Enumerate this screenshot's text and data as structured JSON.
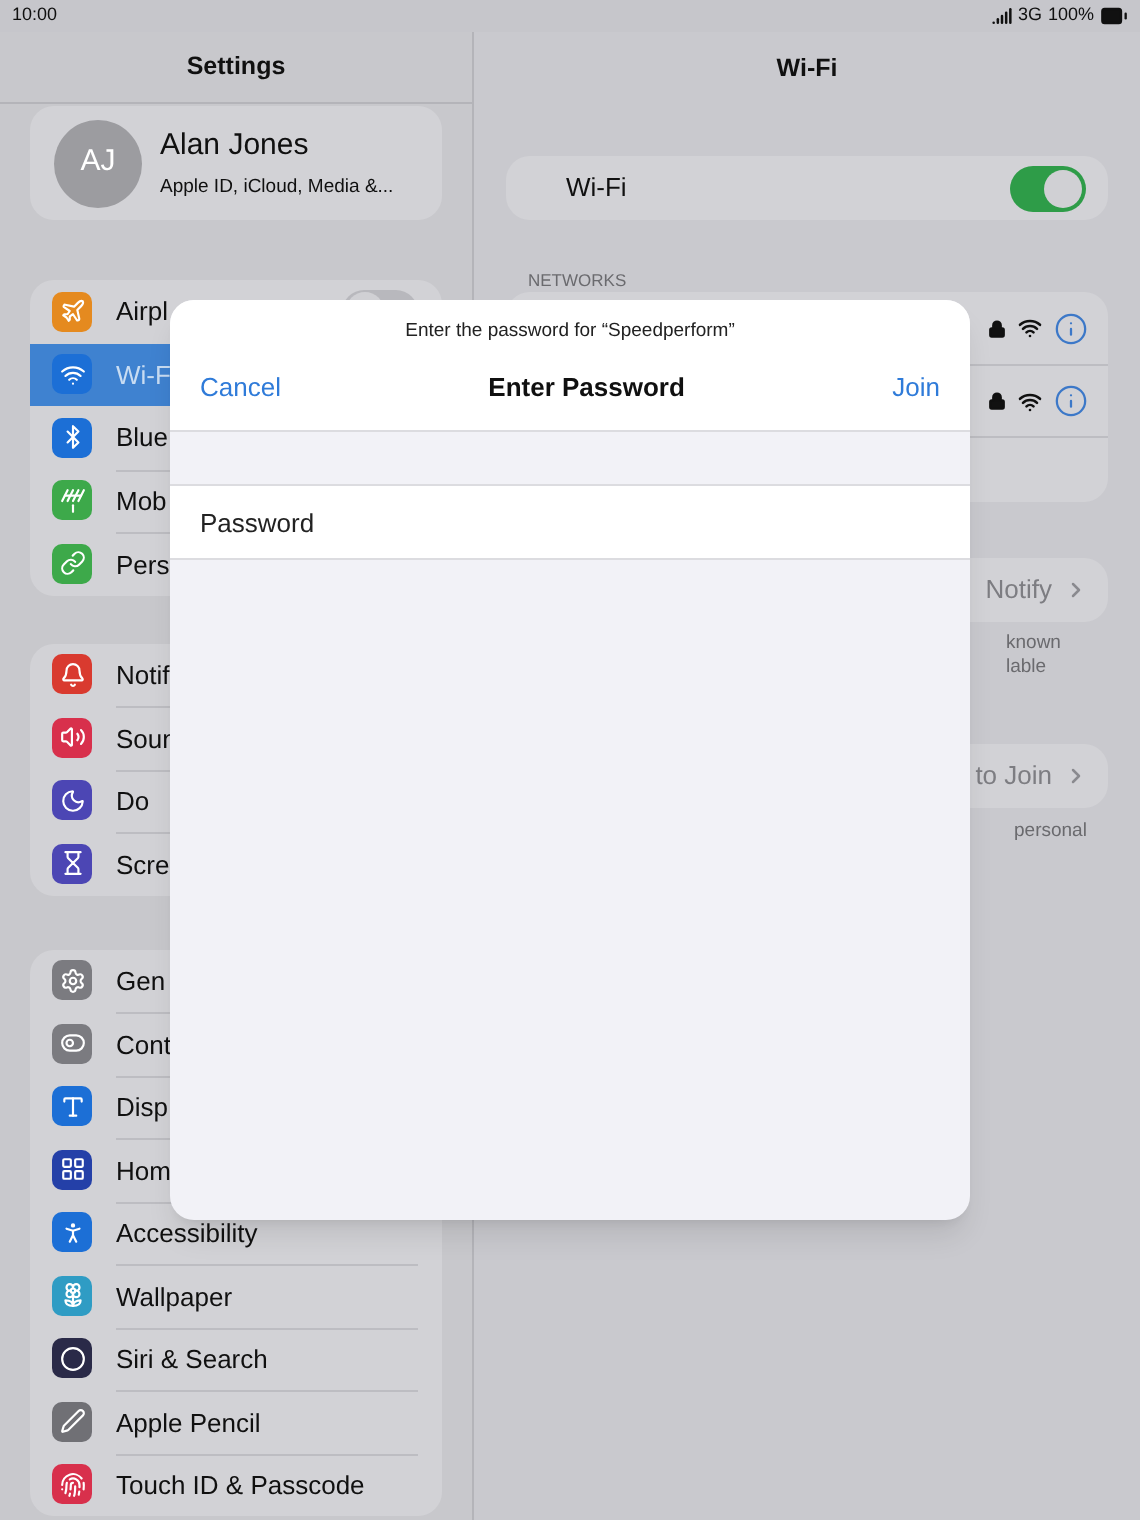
{
  "status_bar": {
    "time": "10:00",
    "network": "3G",
    "battery": "100%"
  },
  "sidebar": {
    "title": "Settings",
    "profile": {
      "initials": "AJ",
      "name": "Alan Jones",
      "subtitle": "Apple ID, iCloud, Media &..."
    },
    "groups": [
      {
        "items": [
          {
            "label": "Airpl",
            "color": "#e58a1f",
            "selected": false,
            "toggle": {
              "on": false
            }
          },
          {
            "label": "Wi-F",
            "color": "#1c6fd6",
            "selected": true
          },
          {
            "label": "Blue",
            "color": "#1c6fd6",
            "selected": false
          },
          {
            "label": "Mob",
            "color": "#3da94a",
            "selected": false
          },
          {
            "label": "Pers",
            "color": "#3da94a",
            "selected": false
          }
        ]
      },
      {
        "items": [
          {
            "label": "Notif",
            "color": "#d93a2f",
            "selected": false
          },
          {
            "label": "Soun",
            "color": "#d8304c",
            "selected": false
          },
          {
            "label": "Do",
            "color": "#4c46b4",
            "selected": false
          },
          {
            "label": "Scre",
            "color": "#4c46b4",
            "selected": false
          }
        ]
      },
      {
        "items": [
          {
            "label": "Gen",
            "color": "#7b7b80",
            "selected": false
          },
          {
            "label": "Cont",
            "color": "#7b7b80",
            "selected": false
          },
          {
            "label": "Disp",
            "color": "#1c6fd6",
            "selected": false
          },
          {
            "label": "Hom",
            "color": "#2440a8",
            "selected": false
          },
          {
            "label": "Accessibility",
            "color": "#1c6fd6",
            "selected": false
          },
          {
            "label": "Wallpaper",
            "color": "#2f9cc4",
            "selected": false
          },
          {
            "label": "Siri & Search",
            "color": "#2a2a48",
            "selected": false
          },
          {
            "label": "Apple Pencil",
            "color": "#707075",
            "selected": false
          },
          {
            "label": "Touch ID & Passcode",
            "color": "#d8304c",
            "selected": false
          }
        ]
      }
    ]
  },
  "detail": {
    "title": "Wi-Fi",
    "wifi": {
      "label": "Wi-Fi",
      "on": true
    },
    "networks_header": "NETWORKS",
    "networks": [
      {
        "kind": "network",
        "secured": true
      },
      {
        "kind": "network",
        "secured": true
      },
      {
        "kind": "other"
      }
    ],
    "ask_row": {
      "value": "Notify"
    },
    "ask_footer": [
      "known",
      "lable"
    ],
    "join_row": {
      "value": "to Join"
    },
    "join_footer": "personal"
  },
  "dialog": {
    "subtitle": "Enter the password for “Speedperform”",
    "title": "Enter Password",
    "cancel": "Cancel",
    "join": "Join",
    "password": {
      "placeholder": "Password"
    }
  }
}
